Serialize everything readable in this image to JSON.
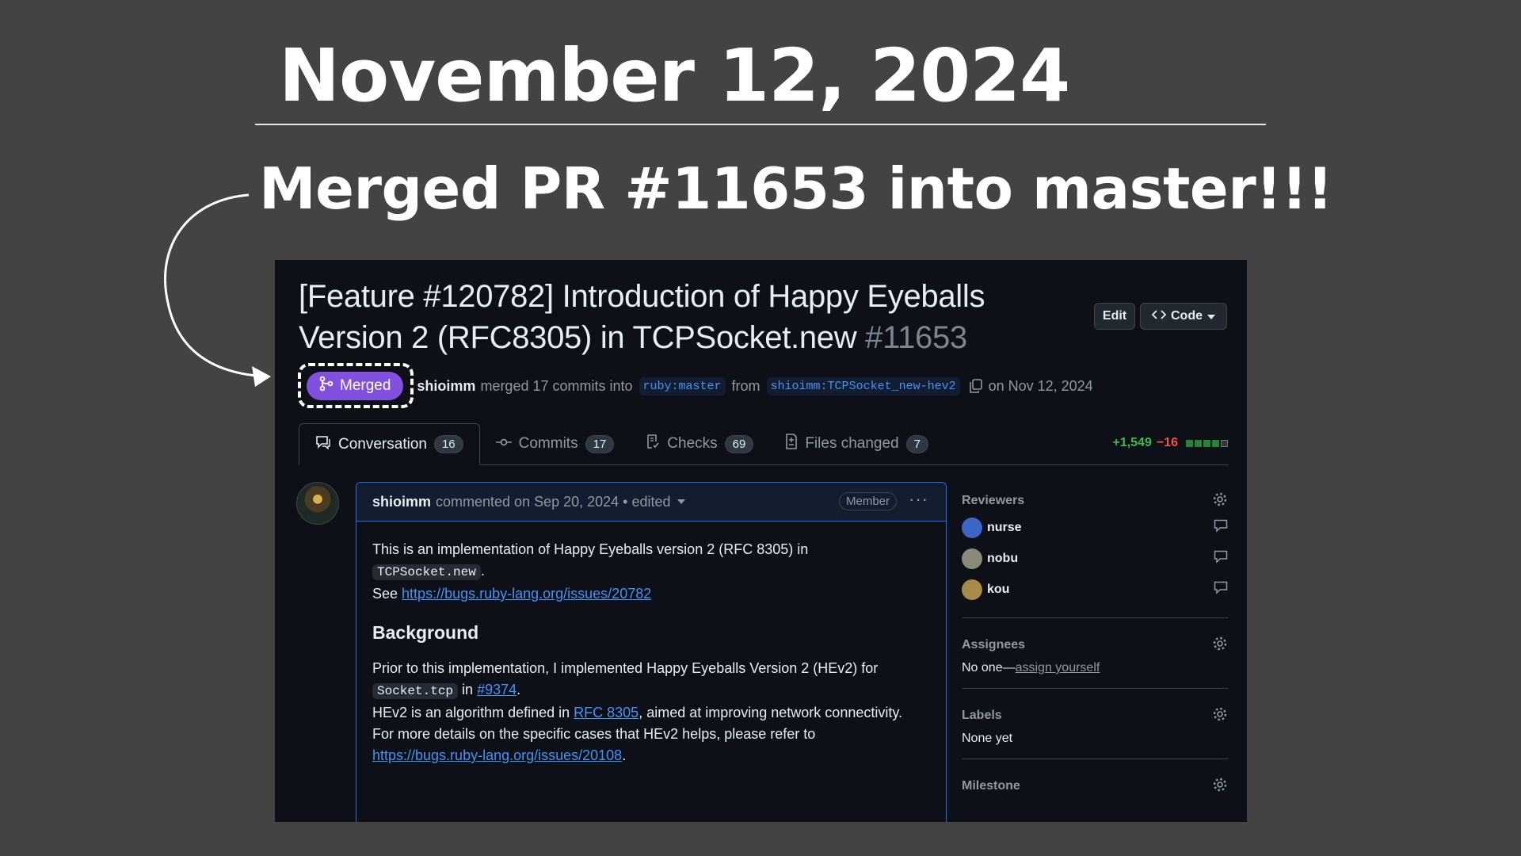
{
  "slide": {
    "title": "November 12, 2024",
    "subtitle": "Merged PR #11653 into master!!!"
  },
  "pr": {
    "title": "[Feature #120782] Introduction of Happy Eyeballs Version 2 (RFC8305) in TCPSocket.new",
    "number": "#11653",
    "edit_label": "Edit",
    "code_label": "Code",
    "status": "Merged",
    "author": "shioimm",
    "merged_text": "merged 17 commits into",
    "base_branch": "ruby:master",
    "from_text": "from",
    "head_branch": "shioimm:TCPSocket_new-hev2",
    "date_text": "on Nov 12, 2024",
    "status_color": "#8250df"
  },
  "tabs": [
    {
      "label": "Conversation",
      "count": "16",
      "icon": "comment-icon"
    },
    {
      "label": "Commits",
      "count": "17",
      "icon": "commit-icon"
    },
    {
      "label": "Checks",
      "count": "69",
      "icon": "checklist-icon"
    },
    {
      "label": "Files changed",
      "count": "7",
      "icon": "file-diff-icon"
    }
  ],
  "diffstat": {
    "additions": "+1,549",
    "deletions": "−16"
  },
  "comment": {
    "author": "shioimm",
    "meta": "commented on Sep 20, 2024 • edited",
    "role": "Member",
    "p1_text": "This is an implementation of Happy Eyeballs version 2 (RFC 8305) in",
    "p1_code": "TCPSocket.new",
    "see_label": "See",
    "see_link": "https://bugs.ruby-lang.org/issues/20782",
    "heading": "Background",
    "bg1": "Prior to this implementation, I implemented Happy Eyeballs Version 2 (HEv2) for",
    "bg_code": "Socket.tcp",
    "in_word": "in",
    "bg_link": "#9374",
    "bg2_a": "HEv2 is an algorithm defined in",
    "bg2_link": "RFC 8305",
    "bg2_b": ", aimed at improving network connectivity.",
    "bg3": "For more details on the specific cases that HEv2 helps, please refer to",
    "bg3_link": "https://bugs.ruby-lang.org/issues/20108"
  },
  "sidebar": {
    "reviewers_label": "Reviewers",
    "reviewers": [
      "nurse",
      "nobu",
      "kou"
    ],
    "assignees_label": "Assignees",
    "assignees_none": "No one—",
    "assignees_link": "assign yourself",
    "labels_label": "Labels",
    "labels_value": "None yet",
    "milestone_label": "Milestone"
  }
}
